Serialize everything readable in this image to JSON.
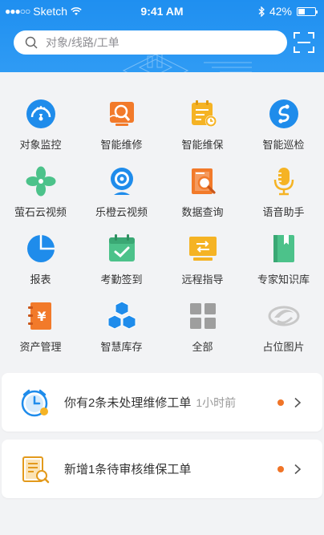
{
  "status_bar": {
    "carrier": "Sketch",
    "time": "9:41 AM",
    "battery_text": "42%",
    "battery_level": 0.42
  },
  "search": {
    "placeholder": "对象/线路/工单"
  },
  "grid": {
    "items": [
      {
        "label": "对象监控",
        "icon": "gauge-icon"
      },
      {
        "label": "智能维修",
        "icon": "repair-icon"
      },
      {
        "label": "智能维保",
        "icon": "maintenance-icon"
      },
      {
        "label": "智能巡检",
        "icon": "inspection-icon"
      },
      {
        "label": "萤石云视频",
        "icon": "pinwheel-icon"
      },
      {
        "label": "乐橙云视频",
        "icon": "webcam-icon"
      },
      {
        "label": "数据查询",
        "icon": "data-search-icon"
      },
      {
        "label": "语音助手",
        "icon": "microphone-icon"
      },
      {
        "label": "报表",
        "icon": "pie-chart-icon"
      },
      {
        "label": "考勤签到",
        "icon": "calendar-check-icon"
      },
      {
        "label": "远程指导",
        "icon": "remote-guide-icon"
      },
      {
        "label": "专家知识库",
        "icon": "book-icon"
      },
      {
        "label": "资产管理",
        "icon": "asset-icon"
      },
      {
        "label": "智慧库存",
        "icon": "cubes-icon"
      },
      {
        "label": "全部",
        "icon": "grid-all-icon"
      },
      {
        "label": "占位图片",
        "icon": "placeholder-icon"
      }
    ]
  },
  "notifications": [
    {
      "text": "你有2条未处理维修工单",
      "time": "1小时前",
      "icon": "clock-icon"
    },
    {
      "text": "新增1条待审核维保工单",
      "time": "",
      "icon": "document-icon"
    }
  ],
  "colors": {
    "header_blue": "#2191f1",
    "icon_blue": "#1f8ceb",
    "icon_orange": "#f27a2a",
    "icon_yellow": "#f5b324",
    "icon_green": "#4cc28a",
    "dot_orange": "#f07427"
  }
}
